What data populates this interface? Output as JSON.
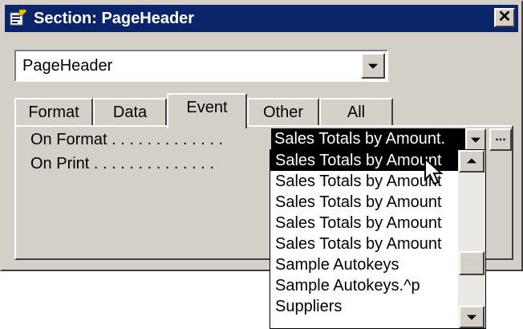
{
  "window": {
    "title": "Section: PageHeader",
    "close_label": "✕"
  },
  "selector": {
    "value": "PageHeader"
  },
  "tabs": [
    {
      "label": "Format",
      "active": false
    },
    {
      "label": "Data",
      "active": false
    },
    {
      "label": "Event",
      "active": true
    },
    {
      "label": "Other",
      "active": false
    },
    {
      "label": "All",
      "active": false
    }
  ],
  "properties": [
    {
      "label": "On Format . . . . . . . . . . . . .",
      "value": "Sales Totals by Amount."
    },
    {
      "label": "On Print . . . . . . . . . . . . . .",
      "value": ""
    }
  ],
  "builder_label": "...",
  "dropdown": {
    "items": [
      {
        "label": "Sales Totals by Amount",
        "selected": true
      },
      {
        "label": "Sales Totals by Amount",
        "selected": false
      },
      {
        "label": "Sales Totals by Amount",
        "selected": false
      },
      {
        "label": "Sales Totals by Amount",
        "selected": false
      },
      {
        "label": "Sales Totals by Amount",
        "selected": false
      },
      {
        "label": "Sample Autokeys",
        "selected": false
      },
      {
        "label": "Sample Autokeys.^p",
        "selected": false
      },
      {
        "label": "Suppliers",
        "selected": false
      }
    ]
  },
  "colors": {
    "titlebar": "#0a246a",
    "selection": "#000000",
    "face": "#d4d0c8"
  },
  "icons": {
    "title": "property-sheet-icon",
    "cursor": "arrow-pointer-icon"
  }
}
